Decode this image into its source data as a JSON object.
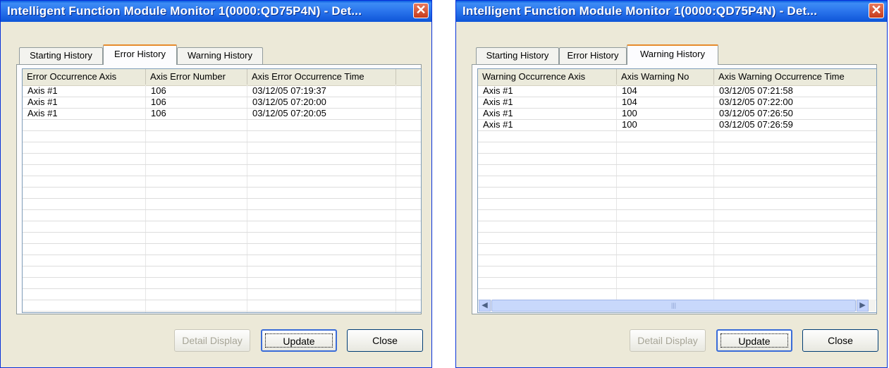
{
  "dialogs": [
    {
      "title": "Intelligent Function Module Monitor 1(0000:QD75P4N) - Det...",
      "tabs": [
        "Starting History",
        "Error History",
        "Warning History"
      ],
      "active_tab": "Error History",
      "columns": [
        "Error Occurrence Axis",
        "Axis Error Number",
        "Axis Error Occurrence Time"
      ],
      "rows": [
        [
          "Axis #1",
          "106",
          "03/12/05 07:19:37"
        ],
        [
          "Axis #1",
          "106",
          "03/12/05 07:20:00"
        ],
        [
          "Axis #1",
          "106",
          "03/12/05 07:20:05"
        ]
      ],
      "buttons": {
        "detail": "Detail Display",
        "update": "Update",
        "close": "Close"
      }
    },
    {
      "title": "Intelligent Function Module Monitor 1(0000:QD75P4N) - Det...",
      "tabs": [
        "Starting History",
        "Error History",
        "Warning History"
      ],
      "active_tab": "Warning History",
      "columns": [
        "Warning Occurrence Axis",
        "Axis Warning No",
        "Axis Warning Occurrence Time"
      ],
      "rows": [
        [
          "Axis #1",
          "104",
          "03/12/05 07:21:58"
        ],
        [
          "Axis #1",
          "104",
          "03/12/05 07:22:00"
        ],
        [
          "Axis #1",
          "100",
          "03/12/05 07:26:50"
        ],
        [
          "Axis #1",
          "100",
          "03/12/05 07:26:59"
        ]
      ],
      "buttons": {
        "detail": "Detail Display",
        "update": "Update",
        "close": "Close"
      }
    }
  ],
  "icons": {
    "close": "close-x-icon",
    "scroll_left": "arrow-left-icon",
    "scroll_right": "arrow-right-icon"
  },
  "colors": {
    "titlebar": "#2a74ec",
    "dialog_bg": "#ece9d8",
    "tab_highlight": "#e68b2c"
  }
}
